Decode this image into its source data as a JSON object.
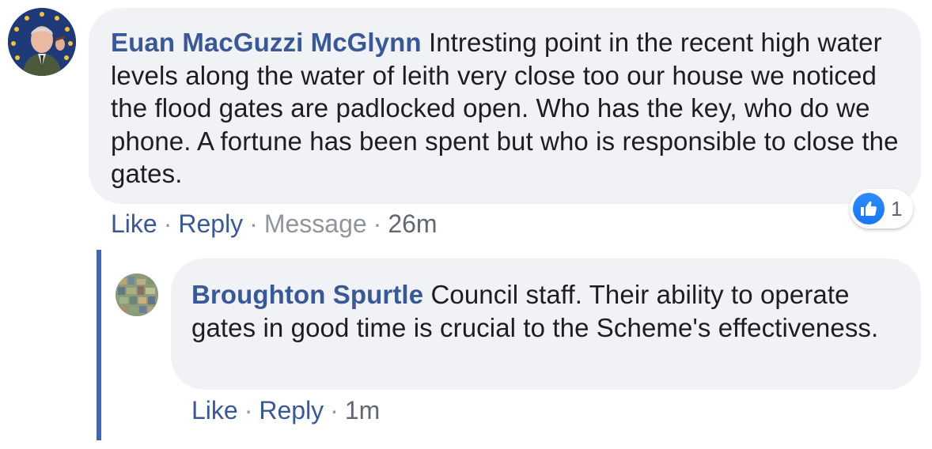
{
  "comment": {
    "author": "Euan MacGuzzi McGlynn",
    "text": "Intresting point in the recent high water levels along the water of leith very close too our house we noticed the flood gates are padlocked open. Who has the key, who do we phone. A fortune has been spent but who is responsible to close the gates.",
    "actions": {
      "like": "Like",
      "reply": "Reply",
      "message": "Message",
      "time": "26m",
      "separator": "·"
    },
    "reaction": {
      "icon": "thumbs-up-icon",
      "count": "1",
      "color": "#1877f2"
    }
  },
  "reply": {
    "author": "Broughton Spurtle",
    "text": "Council staff. Their ability to operate gates in good time is crucial to the Scheme's effectiveness.",
    "actions": {
      "like": "Like",
      "reply": "Reply",
      "time": "1m",
      "separator": "·"
    }
  },
  "colors": {
    "author_link": "#385898",
    "bubble_bg": "#f0f2f5",
    "thread_line": "#4267b2",
    "muted": "#90949c"
  }
}
